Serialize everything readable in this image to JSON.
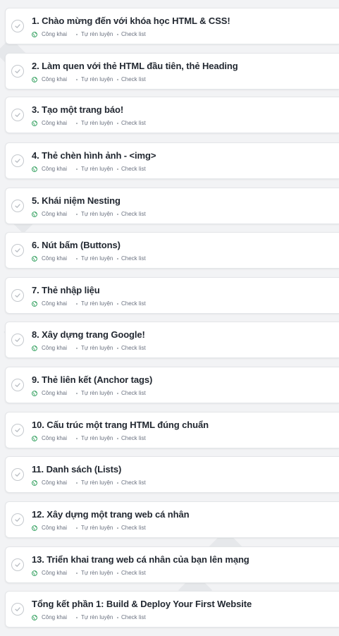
{
  "lessons": [
    {
      "title": "1. Chào mừng đến với khóa học HTML & CSS!",
      "visibility": "Công khai",
      "type": "Tự rèn luyện",
      "format": "Check list"
    },
    {
      "title": "2. Làm quen với thẻ HTML đầu tiên, thẻ Heading",
      "visibility": "Công khai",
      "type": "Tự rèn luyện",
      "format": "Check list"
    },
    {
      "title": "3. Tạo một trang báo!",
      "visibility": "Công khai",
      "type": "Tự rèn luyện",
      "format": "Check list"
    },
    {
      "title": "4. Thẻ chèn hình ảnh - <img>",
      "visibility": "Công khai",
      "type": "Tự rèn luyện",
      "format": "Check list"
    },
    {
      "title": "5. Khái niệm Nesting",
      "visibility": "Công khai",
      "type": "Tự rèn luyện",
      "format": "Check list"
    },
    {
      "title": "6. Nút bấm (Buttons)",
      "visibility": "Công khai",
      "type": "Tự rèn luyện",
      "format": "Check list"
    },
    {
      "title": "7. Thẻ nhập liệu",
      "visibility": "Công khai",
      "type": "Tự rèn luyện",
      "format": "Check list"
    },
    {
      "title": "8. Xây dựng trang Google!",
      "visibility": "Công khai",
      "type": "Tự rèn luyện",
      "format": "Check list"
    },
    {
      "title": "9. Thẻ liên kết (Anchor tags)",
      "visibility": "Công khai",
      "type": "Tự rèn luyện",
      "format": "Check list"
    },
    {
      "title": "10. Cấu trúc một trang HTML đúng chuẩn",
      "visibility": "Công khai",
      "type": "Tự rèn luyện",
      "format": "Check list"
    },
    {
      "title": "11. Danh sách (Lists)",
      "visibility": "Công khai",
      "type": "Tự rèn luyện",
      "format": "Check list"
    },
    {
      "title": "12. Xây dựng một trang web cá nhân",
      "visibility": "Công khai",
      "type": "Tự rèn luyện",
      "format": "Check list"
    },
    {
      "title": "13. Triển khai trang web cá nhân của bạn lên mạng",
      "visibility": "Công khai",
      "type": "Tự rèn luyện",
      "format": "Check list"
    },
    {
      "title": "Tổng kết phần 1: Build & Deploy Your First Website",
      "visibility": "Công khai",
      "type": "Tự rèn luyện",
      "format": "Check list"
    }
  ],
  "colors": {
    "public_icon": "#2e9e5b",
    "check_ring": "#c4c8cd",
    "title_text": "#222831",
    "meta_text": "#6b7280"
  },
  "icons": {
    "status": "check-circle-icon",
    "visibility": "globe-icon"
  }
}
